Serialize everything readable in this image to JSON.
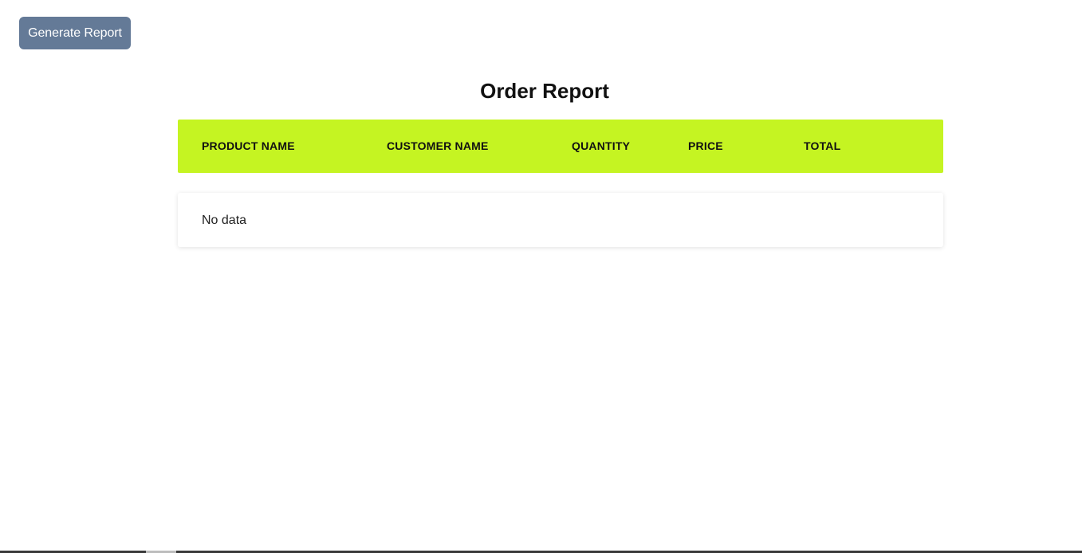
{
  "toolbar": {
    "generate_label": "Generate Report"
  },
  "report": {
    "title": "Order Report",
    "columns": [
      "PRODUCT NAME",
      "CUSTOMER NAME",
      "QUANTITY",
      "PRICE",
      "TOTAL"
    ],
    "empty_message": "No data",
    "rows": []
  },
  "colors": {
    "button": "#647a97",
    "header": "#c5f422"
  }
}
